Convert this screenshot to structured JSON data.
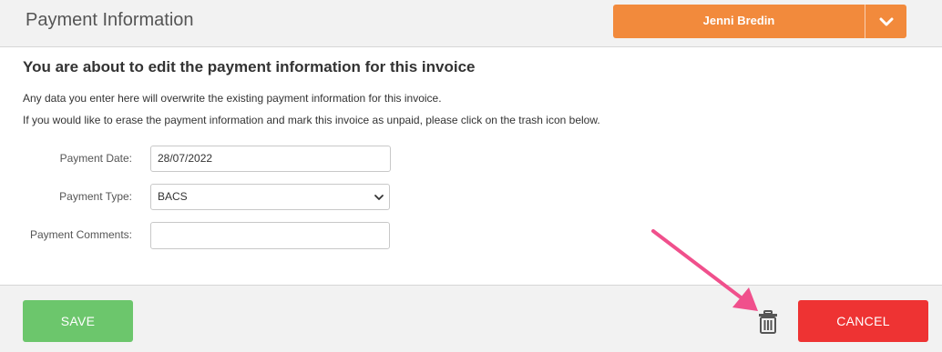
{
  "header": {
    "title": "Payment Information",
    "user_name": "Jenni Bredin"
  },
  "content": {
    "heading": "You are about to edit the payment information for this invoice",
    "line1": "Any data you enter here will overwrite the existing payment information for this invoice.",
    "line2": "If you would like to erase the payment information and mark this invoice as unpaid, please click on the trash icon below."
  },
  "form": {
    "payment_date_label": "Payment Date:",
    "payment_date_value": "28/07/2022",
    "payment_type_label": "Payment Type:",
    "payment_type_value": "BACS",
    "payment_comments_label": "Payment Comments:",
    "payment_comments_value": ""
  },
  "footer": {
    "save_label": "SAVE",
    "cancel_label": "CANCEL"
  },
  "colors": {
    "user_button": "#f28a3c",
    "save_button": "#6cc66c",
    "cancel_button": "#ee3333",
    "annotation_arrow": "#f0508c"
  },
  "icons": {
    "user_dropdown": "chevron-down-icon",
    "delete": "trash-icon",
    "select": "chevron-down-icon"
  }
}
